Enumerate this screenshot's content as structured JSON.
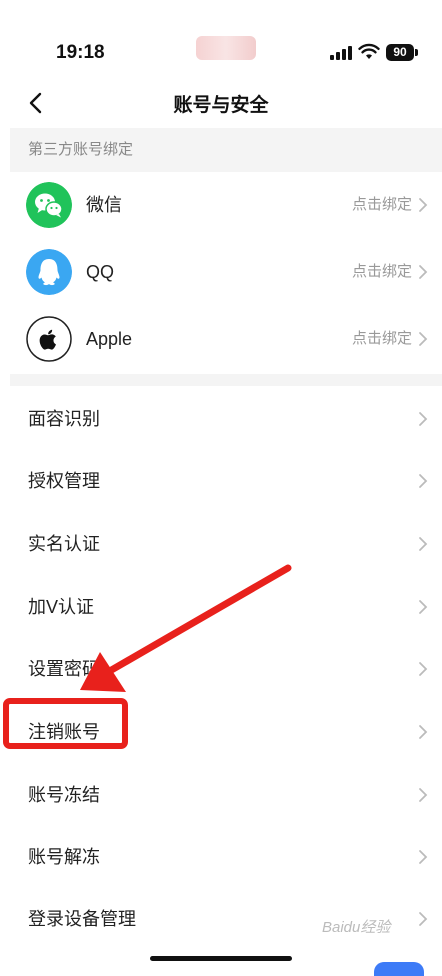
{
  "status_bar": {
    "time": "19:18",
    "battery": "90"
  },
  "nav": {
    "title": "账号与安全"
  },
  "third_party": {
    "header": "第三方账号绑定",
    "items": [
      {
        "label": "微信",
        "action": "点击绑定",
        "icon": "wechat-icon",
        "color": "#20c35a"
      },
      {
        "label": "QQ",
        "action": "点击绑定",
        "icon": "qq-icon",
        "color": "#3aa7f2"
      },
      {
        "label": "Apple",
        "action": "点击绑定",
        "icon": "apple-icon",
        "color": "#ffffff"
      }
    ]
  },
  "menu": {
    "items": [
      {
        "label": "面容识别"
      },
      {
        "label": "授权管理"
      },
      {
        "label": "实名认证"
      },
      {
        "label": "加V认证"
      },
      {
        "label": "设置密码"
      },
      {
        "label": "注销账号"
      },
      {
        "label": "账号冻结"
      },
      {
        "label": "账号解冻"
      },
      {
        "label": "登录设备管理"
      }
    ]
  },
  "watermark": "Baidu经验",
  "annotation": {
    "highlight_color": "#e8211c",
    "highlighted_item": "注销账号"
  }
}
